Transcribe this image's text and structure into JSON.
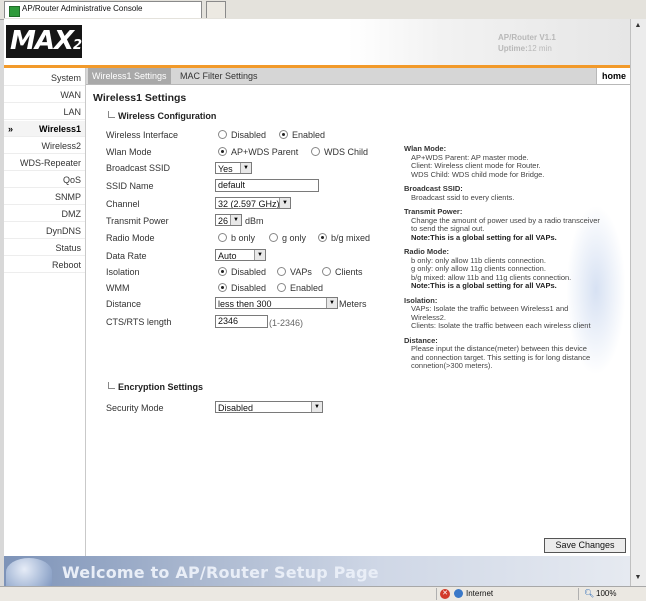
{
  "browser": {
    "tab_title": "AP/Router Administrative Console",
    "status_zone": "Internet",
    "zoom": "100%"
  },
  "header": {
    "logo": "MAX",
    "logo_suffix": "2500",
    "version": "AP/Router V1.1",
    "uptime_label": "Uptime:",
    "uptime_value": "12 min"
  },
  "nav": {
    "items": [
      {
        "label": "System"
      },
      {
        "label": "WAN"
      },
      {
        "label": "LAN"
      },
      {
        "label": "Wireless1"
      },
      {
        "label": "Wireless2"
      },
      {
        "label": "WDS-Repeater"
      },
      {
        "label": "QoS"
      },
      {
        "label": "SNMP"
      },
      {
        "label": "DMZ"
      },
      {
        "label": "DynDNS"
      },
      {
        "label": "Status"
      },
      {
        "label": "Reboot"
      }
    ],
    "active_index": 3,
    "arrow": "»"
  },
  "tabs": {
    "items": [
      "Wireless1 Settings",
      "MAC Filter Settings"
    ],
    "home": "home"
  },
  "content": {
    "title": "Wireless1 Settings",
    "section_wireless": "Wireless Configuration",
    "section_encryption": "Encryption Settings",
    "fields": {
      "interface": {
        "label": "Wireless Interface",
        "options": [
          "Disabled",
          "Enabled"
        ],
        "selected": "Enabled"
      },
      "mode": {
        "label": "Wlan Mode",
        "options": [
          "AP+WDS Parent",
          "WDS Child"
        ],
        "selected": "AP+WDS Parent"
      },
      "broadcast": {
        "label": "Broadcast SSID",
        "value": "Yes"
      },
      "ssid": {
        "label": "SSID Name",
        "value": "default"
      },
      "channel": {
        "label": "Channel",
        "value": "32 (2.597 GHz)"
      },
      "power": {
        "label": "Transmit Power",
        "value": "26",
        "unit": "dBm"
      },
      "radio": {
        "label": "Radio Mode",
        "options": [
          "b only",
          "g only",
          "b/g mixed"
        ],
        "selected": "b/g mixed"
      },
      "rate": {
        "label": "Data Rate",
        "value": "Auto"
      },
      "isolation": {
        "label": "Isolation",
        "options": [
          "Disabled",
          "VAPs",
          "Clients"
        ],
        "selected": "Disabled"
      },
      "wmm": {
        "label": "WMM",
        "options": [
          "Disabled",
          "Enabled"
        ],
        "selected": "Disabled"
      },
      "distance": {
        "label": "Distance",
        "value": "less then 300",
        "unit": "Meters"
      },
      "rts": {
        "label": "CTS/RTS length",
        "value": "2346",
        "hint": "(1-2346)"
      },
      "security": {
        "label": "Security Mode",
        "value": "Disabled"
      }
    },
    "save_button": "Save Changes"
  },
  "help": {
    "wlan_mode_title": "Wlan Mode:",
    "wlan_mode_lines": [
      "AP+WDS Parent: AP master mode.",
      "Client: Wireless client mode for Router.",
      "WDS Child: WDS child mode for Bridge."
    ],
    "broadcast_title": "Broadcast SSID:",
    "broadcast_lines": [
      "Broadcast ssid to every clients."
    ],
    "power_title": "Transmit Power:",
    "power_lines": [
      "Change the amount of power used by a radio transceiver to send the signal out."
    ],
    "power_note": "Note:This is a global setting for all VAPs.",
    "radio_title": "Radio Mode:",
    "radio_lines": [
      "b only: only allow 11b clients connection.",
      "g only: only allow 11g clients connection.",
      "b/g mixed: allow 11b and 11g clients connection."
    ],
    "radio_note": "Note:This is a global setting for all VAPs.",
    "isolation_title": "Isolation:",
    "isolation_lines": [
      "VAPs: Isolate the traffic between Wireless1 and Wireless2.",
      "Clients: Isolate the traffic between each wireless client"
    ],
    "distance_title": "Distance:",
    "distance_lines": [
      "Please input the distance(meter) between this device and connection target. This setting is for long distance connetion(>300 meters)."
    ]
  },
  "footer": {
    "welcome": "Welcome to AP/Router Setup Page"
  }
}
